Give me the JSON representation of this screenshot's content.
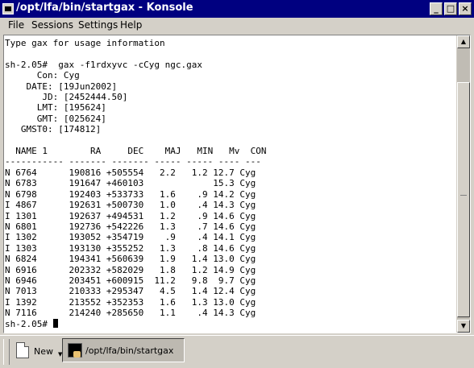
{
  "window": {
    "title": "/opt/lfa/bin/startgax - Konsole",
    "buttons": {
      "minimize": "_",
      "maximize": "□",
      "close": "×"
    }
  },
  "menubar": {
    "items": [
      "File",
      "Sessions",
      "Settings",
      "Help"
    ]
  },
  "terminal": {
    "lines": [
      "Type gax for usage information",
      "",
      "sh-2.05#  gax -f1rdxyvc -cCyg ngc.gax",
      "      Con: Cyg",
      "    DATE: [19Jun2002]",
      "       JD: [2452444.50]",
      "      LMT: [195624]",
      "      GMT: [025624]",
      "   GMST0: [174812]",
      "",
      "  NAME 1        RA     DEC    MAJ   MIN   Mv  CON",
      "----------- ------- ------- ----- ----- ---- ---",
      "N 6764      190816 +505554   2.2   1.2 12.7 Cyg",
      "N 6783      191647 +460103             15.3 Cyg",
      "N 6798      192403 +533733   1.6    .9 14.2 Cyg",
      "I 4867      192631 +500730   1.0    .4 14.3 Cyg",
      "I 1301      192637 +494531   1.2    .9 14.6 Cyg",
      "N 6801      192736 +542226   1.3    .7 14.6 Cyg",
      "I 1302      193052 +354719    .9    .4 14.1 Cyg",
      "I 1303      193130 +355252   1.3    .8 14.6 Cyg",
      "N 6824      194341 +560639   1.9   1.4 13.0 Cyg",
      "N 6916      202332 +582029   1.8   1.2 14.9 Cyg",
      "N 6946      203451 +600915  11.2   9.8  9.7 Cyg",
      "N 7013      210333 +295347   4.5   1.4 12.4 Cyg",
      "I 1392      213552 +352353   1.6   1.3 13.0 Cyg",
      "N 7116      214240 +285650   1.1    .4 14.3 Cyg"
    ],
    "prompt": "sh-2.05# "
  },
  "scrollbar": {
    "position": 0.93
  },
  "taskbar": {
    "new_label": "New",
    "task_label": "/opt/lfa/bin/startgax"
  }
}
